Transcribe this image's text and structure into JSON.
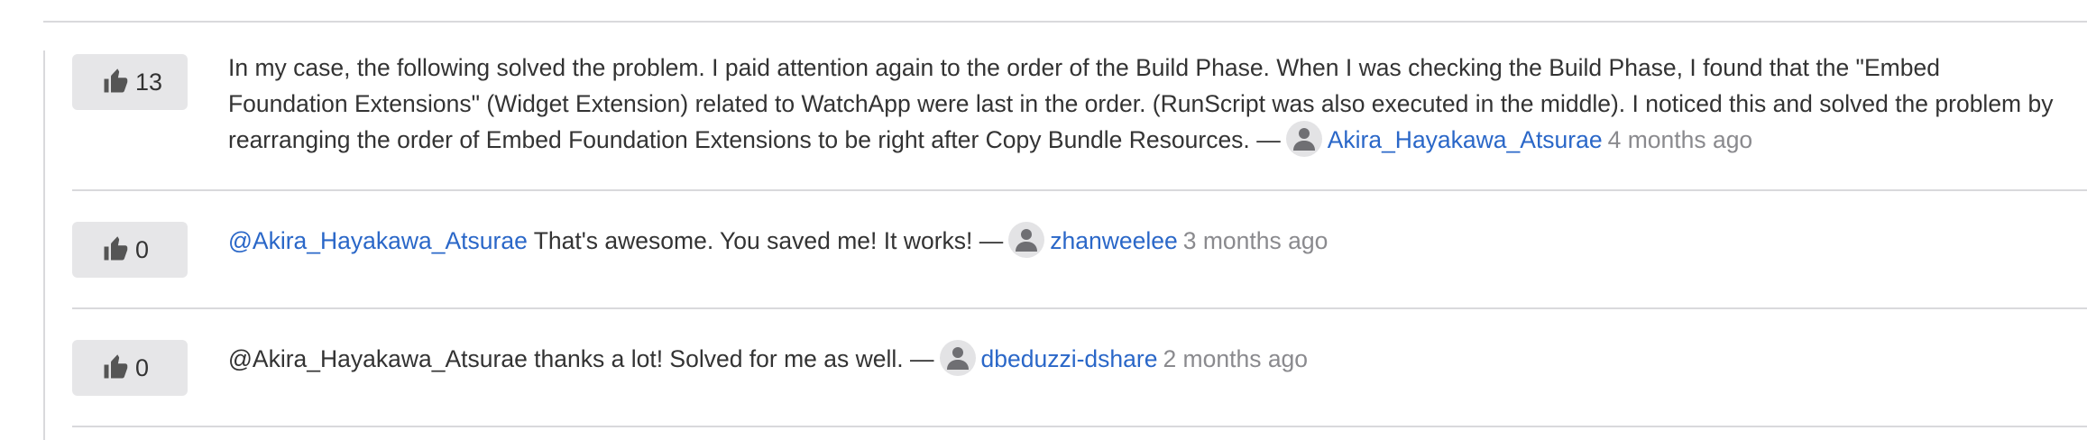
{
  "comments": [
    {
      "votes": "13",
      "mention": "",
      "text": "In my case, the following solved the problem. I paid attention again to the order of the Build Phase. When I was checking the Build Phase, I found that the \"Embed Foundation Extensions\" (Widget Extension) related to WatchApp were last in the order. (RunScript was also executed in the middle). I noticed this and solved the problem by rearranging the order of Embed Foundation Extensions to be right after Copy Bundle Resources.",
      "separator": "—",
      "author": "Akira_Hayakawa_Atsurae",
      "time": "4 months ago"
    },
    {
      "votes": "0",
      "mention": "@Akira_Hayakawa_Atsurae",
      "text": "That's awesome. You saved me! It works!",
      "separator": "—",
      "author": "zhanweelee",
      "time": "3 months ago"
    },
    {
      "votes": "0",
      "mention": "",
      "text": "@Akira_Hayakawa_Atsurae thanks a lot! Solved for me as well.",
      "separator": "—",
      "author": "dbeduzzi-dshare",
      "time": "2 months ago"
    }
  ],
  "icons": {
    "vote": "thumbs-up-icon",
    "avatar": "user-avatar-icon"
  },
  "colors": {
    "link": "#2a67c8",
    "muted": "#8a8a8e",
    "vote_bg": "#e6e6e8",
    "divider": "#d9d9dc"
  }
}
